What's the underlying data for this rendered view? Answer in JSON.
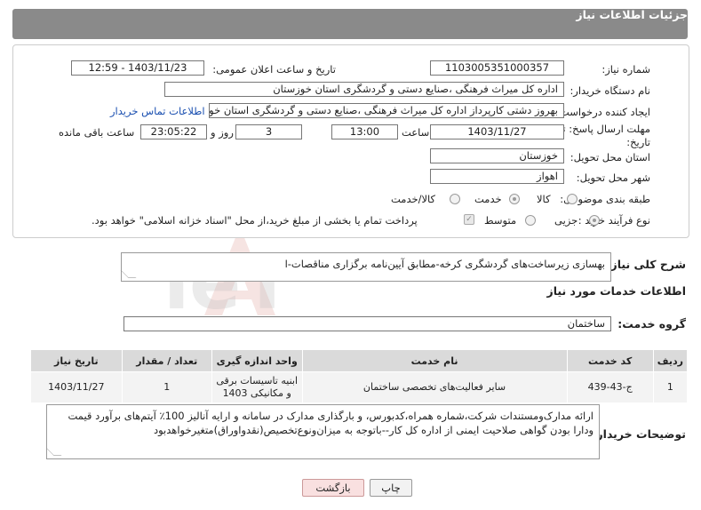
{
  "header": {
    "title": "جزئیات اطلاعات نیاز"
  },
  "form": {
    "need_number_label": "شماره نیاز:",
    "need_number": "1103005351000357",
    "announce_label": "تاریخ و ساعت اعلان عمومی:",
    "announce_value": "1403/11/23 - 12:59",
    "buyer_org_label": "نام دستگاه خریدار:",
    "buyer_org": "اداره کل میراث فرهنگی ،صنایع دستی و گردشگری استان خوزستان",
    "creator_label": "ایجاد کننده درخواست:",
    "creator": "بهروز دشتی کارپرداز اداره کل میراث فرهنگی ،صنایع دستی و گردشگری استان خوزستان",
    "contact_link": "اطلاعات تماس خریدار",
    "deadline_label_1": "مهلت ارسال پاسخ: تا",
    "deadline_label_2": "تاریخ:",
    "deadline_date": "1403/11/27",
    "time_label": "ساعت",
    "deadline_time": "13:00",
    "days_value": "3",
    "days_label": "روز و",
    "remaining_value": "23:05:22",
    "remaining_label": "ساعت باقی مانده",
    "province_label": "استان محل تحویل:",
    "province": "خوزستان",
    "city_label": "شهر محل تحویل:",
    "city": "اهواز",
    "category_label": "طبقه بندی موضوعی:",
    "category_options": [
      "کالا",
      "خدمت",
      "کالا/خدمت"
    ],
    "category_selected": "خدمت",
    "process_label": "نوع فرآیند خرید :",
    "process_options": [
      "جزیی",
      "متوسط"
    ],
    "process_selected": "جزیی",
    "treasury_note": "پرداخت تمام یا بخشی از مبلغ خرید،از محل \"اسناد خزانه اسلامی\" خواهد بود."
  },
  "description": {
    "label": "شرح کلی نیاز:",
    "text": "بهسازی زیرساخت‌های گردشگری کرخه-مطابق آیین‌نامه برگزاری مناقصات-ا"
  },
  "services": {
    "section_title": "اطلاعات خدمات مورد نیاز",
    "group_label": "گروه خدمت:",
    "group_value": "ساختمان",
    "columns": [
      "ردیف",
      "کد خدمت",
      "نام خدمت",
      "واحد اندازه گیری",
      "تعداد / مقدار",
      "تاریخ نیاز"
    ],
    "rows": [
      {
        "index": "1",
        "code": "ج-43-439",
        "name": "سایر فعالیت‌های تخصصی ساختمان",
        "unit_line1": "ابنیه تاسیسات برقی",
        "unit_line2": "و مکانیکی 1403",
        "qty": "1",
        "date": "1403/11/27"
      }
    ]
  },
  "buyer_notes": {
    "label": "توضیحات خریدار:",
    "line1": "ارائه مدارک‌ومستندات شرکت،شماره همراه،کدبورس، و بارگذاری مدارک در سامانه و ارایه آنالیز 100٪ آیتم‌های برآورد قیمت",
    "line2": "ودارا بودن گواهی صلاحیت ایمنی از اداره کل کار--باتوجه به میزان‌ونوع‌تخصیص(نقدواوراق)متغیرخواهدبود"
  },
  "buttons": {
    "print": "چاپ",
    "back": "بازگشت"
  },
  "watermark": {
    "text": "AriaTender.neT"
  }
}
